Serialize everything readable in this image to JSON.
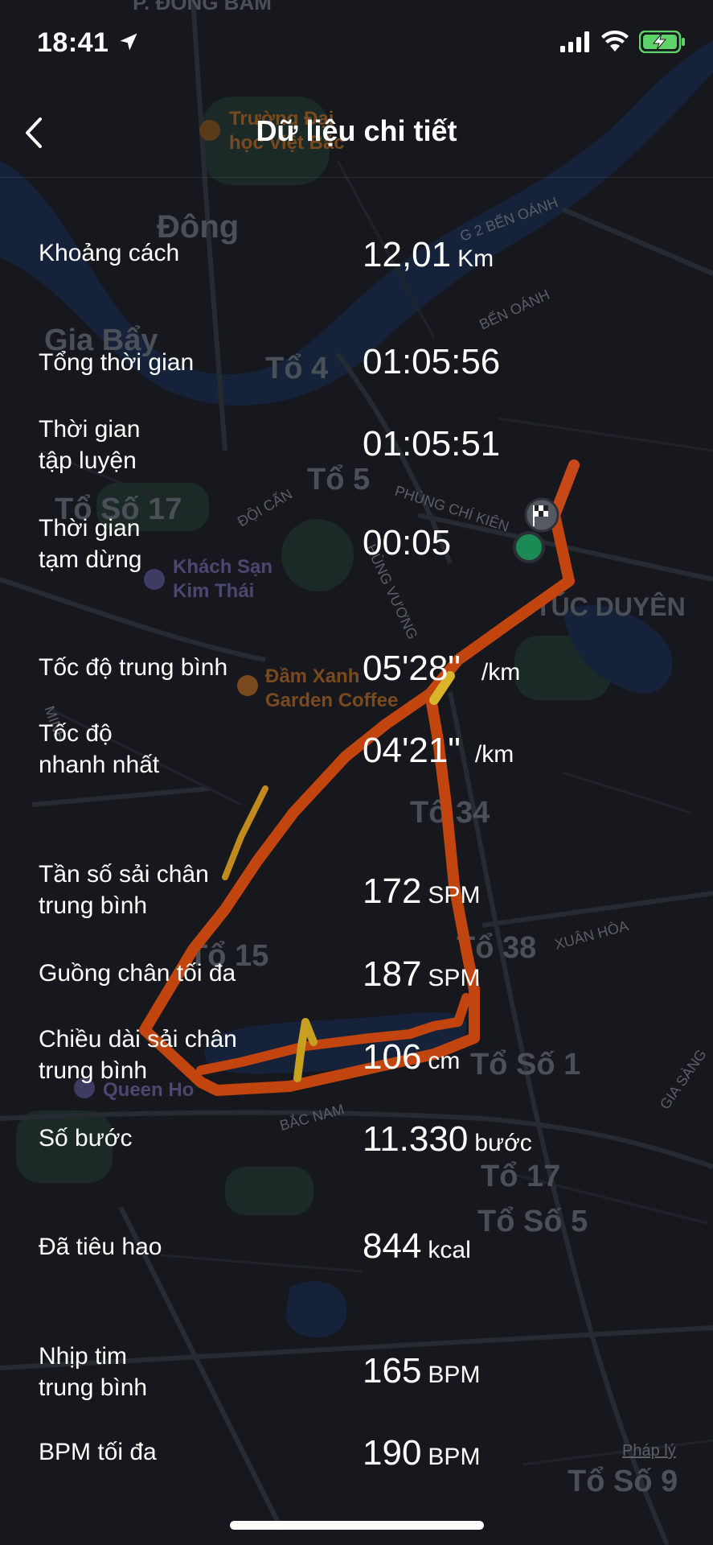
{
  "status_bar": {
    "time": "18:41"
  },
  "header": {
    "title": "Dữ liệu chi tiết"
  },
  "map": {
    "labels": {
      "district_top": "P. ĐỒNG BẨM",
      "dong": "Đông",
      "gia_bay": "Gia Bẩy",
      "to4": "Tổ 4",
      "to5": "Tổ 5",
      "to_so_17": "Tổ Số 17",
      "tuc_duyen": "TÚC DUYÊN",
      "to34": "Tổ 34",
      "to15": "Tổ 15",
      "to38": "Tổ 38",
      "to_so_1": "Tổ Số 1",
      "to17": "Tổ 17",
      "to_so_5": "Tổ Số 5",
      "to_so_9": "Tổ Số 9",
      "truong": "Trường Đại",
      "truong2": "học Việt Bắc",
      "khach_san": "Khách Sạn",
      "khach_san2": "Kim Thái",
      "dam_xanh": "Đầm Xanh",
      "dam_xanh2": "Garden Coffee",
      "queen": "Queen Ho",
      "ben_oanh1": "G 2 BẾN OÁNH",
      "ben_oanh2": "BẾN OÁNH",
      "phung_chi_kien": "PHÙNG CHÍ KIÊN",
      "doi_can": "ĐỘI CẤN",
      "hung_vuong": "HÙNG VƯƠNG",
      "minh": "MINH",
      "bac_nam": "BẮC NAM",
      "xuan_hoa": "XUÂN HÒA",
      "gia_sang": "GIA SÀNG"
    },
    "legal": "Pháp lý"
  },
  "stats": [
    {
      "label": "Khoảng cách",
      "value": "12,01",
      "unit": "Km"
    },
    {
      "label": "Tổng thời gian",
      "value": "01:05:56",
      "unit": ""
    },
    {
      "label": "Thời gian\ntập luyện",
      "value": "01:05:51",
      "unit": ""
    },
    {
      "label": "Thời gian\ntạm dừng",
      "value": "00:05",
      "unit": ""
    },
    {
      "label": "Tốc độ trung bình",
      "value": "05'28\"",
      "unit": "/km"
    },
    {
      "label": "Tốc độ\nnhanh nhất",
      "value": "04'21\"",
      "unit": "/km"
    },
    {
      "label": "Tần số sải chân\ntrung bình",
      "value": "172",
      "unit": "SPM"
    },
    {
      "label": "Guồng chân tối đa",
      "value": "187",
      "unit": "SPM"
    },
    {
      "label": "Chiều dài sải chân\ntrung bình",
      "value": "106",
      "unit": "cm"
    },
    {
      "label": "Số bước",
      "value": "11.330",
      "unit": "bước"
    },
    {
      "label": "Đã tiêu hao",
      "value": "844",
      "unit": "kcal"
    },
    {
      "label": "Nhịp tim\ntrung bình",
      "value": "165",
      "unit": "BPM"
    },
    {
      "label": "BPM tối đa",
      "value": "190",
      "unit": "BPM"
    }
  ]
}
